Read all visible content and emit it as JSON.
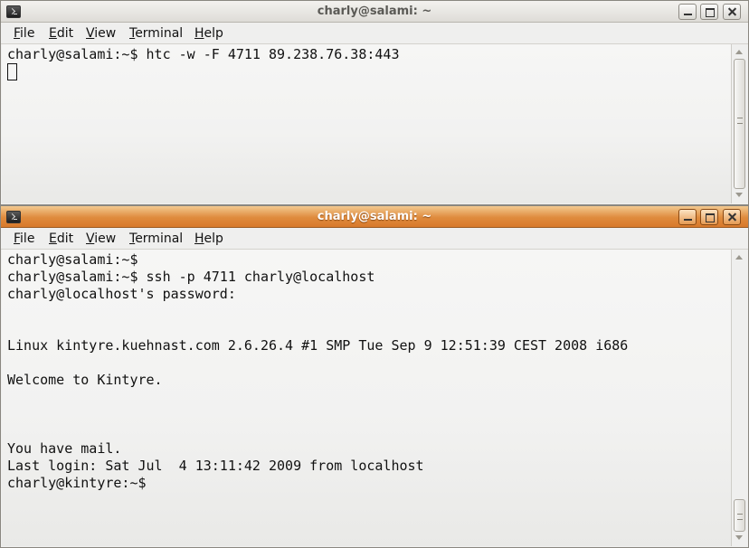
{
  "colors": {
    "inactive_titlebar": "#dedcd7",
    "active_titlebar": "#df8b3d",
    "terminal_bg": "#f2f2f1",
    "terminal_fg": "#111111"
  },
  "menu": {
    "file": {
      "accel": "F",
      "rest": "ile"
    },
    "edit": {
      "accel": "E",
      "rest": "dit"
    },
    "view": {
      "accel": "V",
      "rest": "iew"
    },
    "terminal": {
      "accel": "T",
      "rest": "erminal"
    },
    "help": {
      "accel": "H",
      "rest": "elp"
    }
  },
  "window1": {
    "title": "charly@salami: ~",
    "lines": [
      "charly@salami:~$ htc -w -F 4711 89.238.76.38:443"
    ]
  },
  "window2": {
    "title": "charly@salami: ~",
    "lines": [
      "charly@salami:~$",
      "charly@salami:~$ ssh -p 4711 charly@localhost",
      "charly@localhost's password:",
      "",
      "",
      "Linux kintyre.kuehnast.com 2.6.26.4 #1 SMP Tue Sep 9 12:51:39 CEST 2008 i686",
      "",
      "Welcome to Kintyre.",
      "",
      "",
      "",
      "You have mail.",
      "Last login: Sat Jul  4 13:11:42 2009 from localhost",
      "charly@kintyre:~$"
    ]
  }
}
